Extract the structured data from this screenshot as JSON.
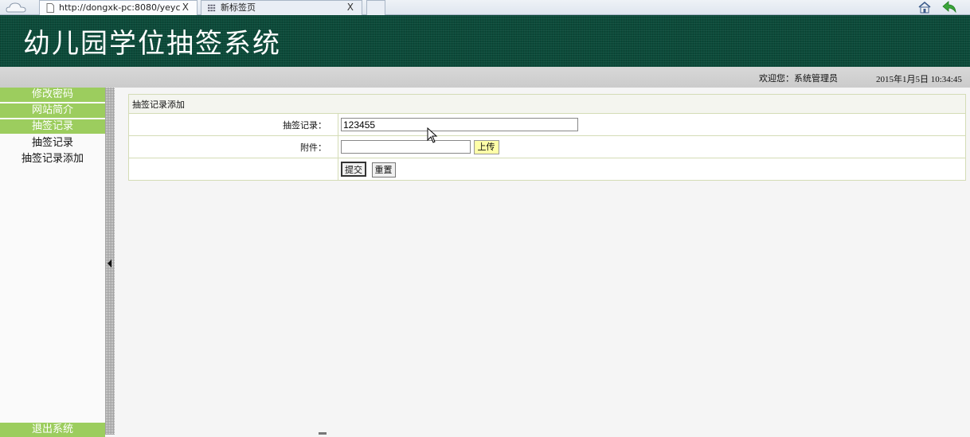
{
  "browser": {
    "tabs": [
      {
        "label": "http://dongxk-pc:8080/yeyc",
        "close": "X"
      },
      {
        "label": "新标签页",
        "close": "X"
      }
    ]
  },
  "header": {
    "title": "幼儿园学位抽签系统"
  },
  "status": {
    "welcome": "欢迎您：系统管理员",
    "datetime": "2015年1月5日  10:34:45"
  },
  "sidebar": {
    "items": [
      {
        "label": "修改密码"
      },
      {
        "label": "网站简介"
      },
      {
        "label": "抽签记录"
      }
    ],
    "subitems": [
      {
        "label": "抽签记录"
      },
      {
        "label": "抽签记录添加"
      }
    ],
    "logout": "退出系统"
  },
  "form": {
    "caption": "抽签记录添加",
    "record_label": "抽签记录：",
    "record_value": "123455",
    "attachment_label": "附件：",
    "upload_label": "上传",
    "submit_label": "提交",
    "reset_label": "重置"
  },
  "colors": {
    "header_bg": "#0c4b3a",
    "menu_green": "#9ccd5e",
    "table_border": "#d4dcb6"
  },
  "icons": [
    "home-icon",
    "back-arrow-icon",
    "collapse-arrow-icon",
    "mouse-cursor-icon"
  ]
}
